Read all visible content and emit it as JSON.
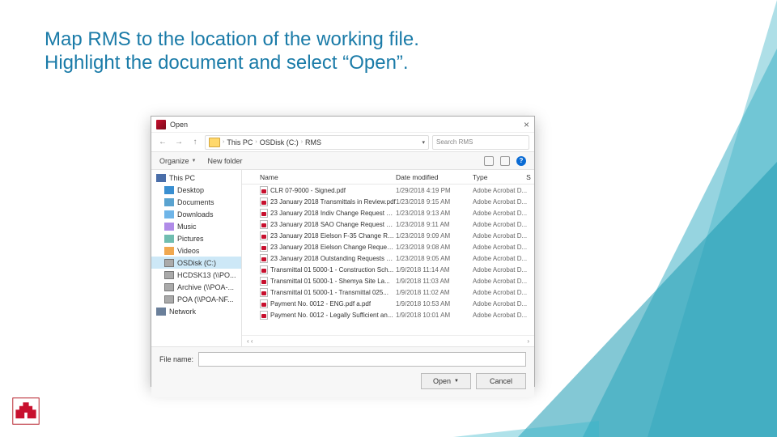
{
  "slide": {
    "title_line1": "Map RMS to the location of the working file.",
    "title_line2": "Highlight the document and select “Open”."
  },
  "dialog": {
    "title": "Open",
    "close": "×",
    "nav": {
      "back": "←",
      "fwd": "→",
      "up": "↑",
      "path": [
        "This PC",
        "OSDisk (C:)",
        "RMS"
      ],
      "search_placeholder": "Search RMS"
    },
    "toolbar": {
      "organize": "Organize",
      "newfolder": "New folder"
    },
    "sidebar": [
      {
        "label": "This PC",
        "cls": "pc"
      },
      {
        "label": "Desktop",
        "cls": "desktop",
        "indent": true
      },
      {
        "label": "Documents",
        "cls": "folder",
        "indent": true
      },
      {
        "label": "Downloads",
        "cls": "dl",
        "indent": true
      },
      {
        "label": "Music",
        "cls": "music",
        "indent": true
      },
      {
        "label": "Pictures",
        "cls": "pics",
        "indent": true
      },
      {
        "label": "Videos",
        "cls": "video",
        "indent": true
      },
      {
        "label": "OSDisk (C:)",
        "cls": "drive",
        "indent": true,
        "sel": true
      },
      {
        "label": "HCDSK13 (\\\\PO...",
        "cls": "drive",
        "indent": true
      },
      {
        "label": "Archive (\\\\POA-...",
        "cls": "drive",
        "indent": true
      },
      {
        "label": "POA (\\\\POA-NF...",
        "cls": "drive",
        "indent": true
      },
      {
        "label": "Network",
        "cls": "net"
      }
    ],
    "columns": {
      "check": " ",
      "name": "Name",
      "date": "Date modified",
      "type": "Type",
      "st": "S"
    },
    "files": [
      {
        "name": "CLR 07-9000 - Signed.pdf",
        "date": "1/29/2018 4:19 PM",
        "type": "Adobe Acrobat D..."
      },
      {
        "name": "23 January 2018 Transmittals in Review.pdf",
        "date": "1/23/2018 9:15 AM",
        "type": "Adobe Acrobat D..."
      },
      {
        "name": "23 January 2018 Indiv Change Request Re...",
        "date": "1/23/2018 9:13 AM",
        "type": "Adobe Acrobat D..."
      },
      {
        "name": "23 January 2018 SAO Change Request Re...",
        "date": "1/23/2018 9:11 AM",
        "type": "Adobe Acrobat D..."
      },
      {
        "name": "23 January 2018 Eielson F-35 Change Req...",
        "date": "1/23/2018 9:09 AM",
        "type": "Adobe Acrobat D..."
      },
      {
        "name": "23 January 2018 Eielson Change Request ...",
        "date": "1/23/2018 9:08 AM",
        "type": "Adobe Acrobat D..."
      },
      {
        "name": "23 January 2018 Outstanding Requests Fo...",
        "date": "1/23/2018 9:05 AM",
        "type": "Adobe Acrobat D..."
      },
      {
        "name": "Transmittal 01 5000-1 - Construction Sch...",
        "date": "1/9/2018 11:14 AM",
        "type": "Adobe Acrobat D..."
      },
      {
        "name": "Transmittal 01 5000-1 - Shemya Site La...",
        "date": "1/9/2018 11:03 AM",
        "type": "Adobe Acrobat D..."
      },
      {
        "name": "Transmittal 01 5000-1 - Transmittal 025...",
        "date": "1/9/2018 11:02 AM",
        "type": "Adobe Acrobat D..."
      },
      {
        "name": "Payment No. 0012 - ENG.pdf a.pdf",
        "date": "1/9/2018 10:53 AM",
        "type": "Adobe Acrobat D..."
      },
      {
        "name": "Payment No. 0012 - Legally Sufficient an...",
        "date": "1/9/2018 10:01 AM",
        "type": "Adobe Acrobat D..."
      }
    ],
    "filename_label": "File name:",
    "buttons": {
      "open": "Open",
      "cancel": "Cancel"
    },
    "scroll": {
      "left": "‹ ‹",
      "right": "›"
    }
  }
}
